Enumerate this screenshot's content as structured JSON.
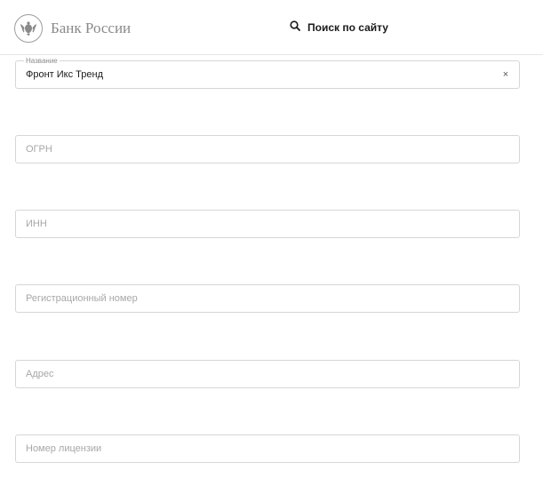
{
  "header": {
    "brand": "Банк России",
    "search_label": "Поиск по сайту",
    "logo_icon": "double-headed-eagle-icon",
    "search_icon": "search-icon"
  },
  "form": {
    "name": {
      "label": "Название",
      "value": "Фронт Икс Тренд",
      "clear": "×"
    },
    "ogrn": {
      "placeholder": "ОГРН"
    },
    "inn": {
      "placeholder": "ИНН"
    },
    "reg_number": {
      "placeholder": "Регистрационный номер"
    },
    "address": {
      "placeholder": "Адрес"
    },
    "license_number": {
      "placeholder": "Номер лицензии"
    }
  },
  "colors": {
    "border": "#d6d6d6",
    "placeholder": "#a7a7a7",
    "brand_text": "#8a8a8a"
  }
}
